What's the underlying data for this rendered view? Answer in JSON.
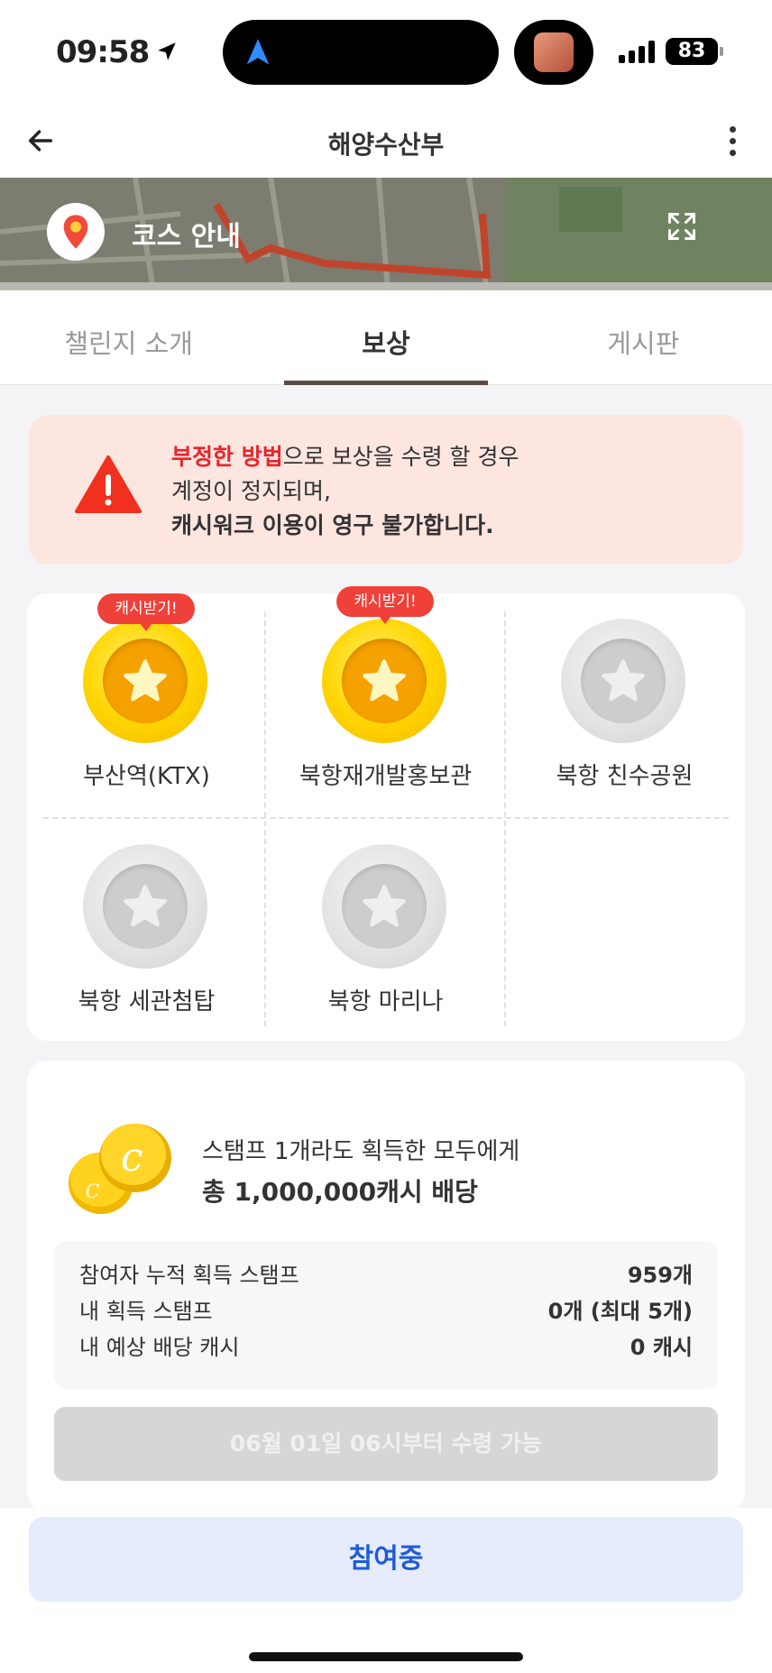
{
  "status_bar": {
    "time": "09:58",
    "battery": "83"
  },
  "header": {
    "title": "해양수산부"
  },
  "map": {
    "course_label": "코스 안내"
  },
  "tabs": [
    {
      "label": "챌린지 소개",
      "active": false
    },
    {
      "label": "보상",
      "active": true
    },
    {
      "label": "게시판",
      "active": false
    }
  ],
  "warning": {
    "highlight": "부정한 방법",
    "line1_rest": "으로 보상을 수령 할 경우",
    "line2": "계정이 정지되며,",
    "line3": "캐시워크 이용이 영구 불가합니다."
  },
  "stamps": [
    {
      "label": "부산역(KTX)",
      "badge": "캐시받기!",
      "state": "gold"
    },
    {
      "label": "북항재개발홍보관",
      "badge": "캐시받기!",
      "state": "gold"
    },
    {
      "label": "북항 친수공원",
      "badge": "",
      "state": "gray"
    },
    {
      "label": "북항 세관첨탑",
      "badge": "",
      "state": "gray"
    },
    {
      "label": "북항 마리나",
      "badge": "",
      "state": "gray"
    }
  ],
  "reward": {
    "line1": "스탬프 1개라도 획득한 모두에게",
    "line2": "총 1,000,000캐시 배당",
    "stats": [
      {
        "label": "참여자 누적 획득 스탬프",
        "value": "959개"
      },
      {
        "label": "내 획득 스탬프",
        "value": "0개 (최대 5개)"
      },
      {
        "label": "내 예상 배당 캐시",
        "value": "0 캐시"
      }
    ],
    "claim_button": "06월 01일 06시부터 수령 가능"
  },
  "bottom": {
    "participate_button": "참여중"
  },
  "colors": {
    "accent_blue": "#1f5ad8",
    "warning_red": "#e8262b",
    "gold": "#ffd400",
    "tab_indicator": "#5a4b48"
  }
}
